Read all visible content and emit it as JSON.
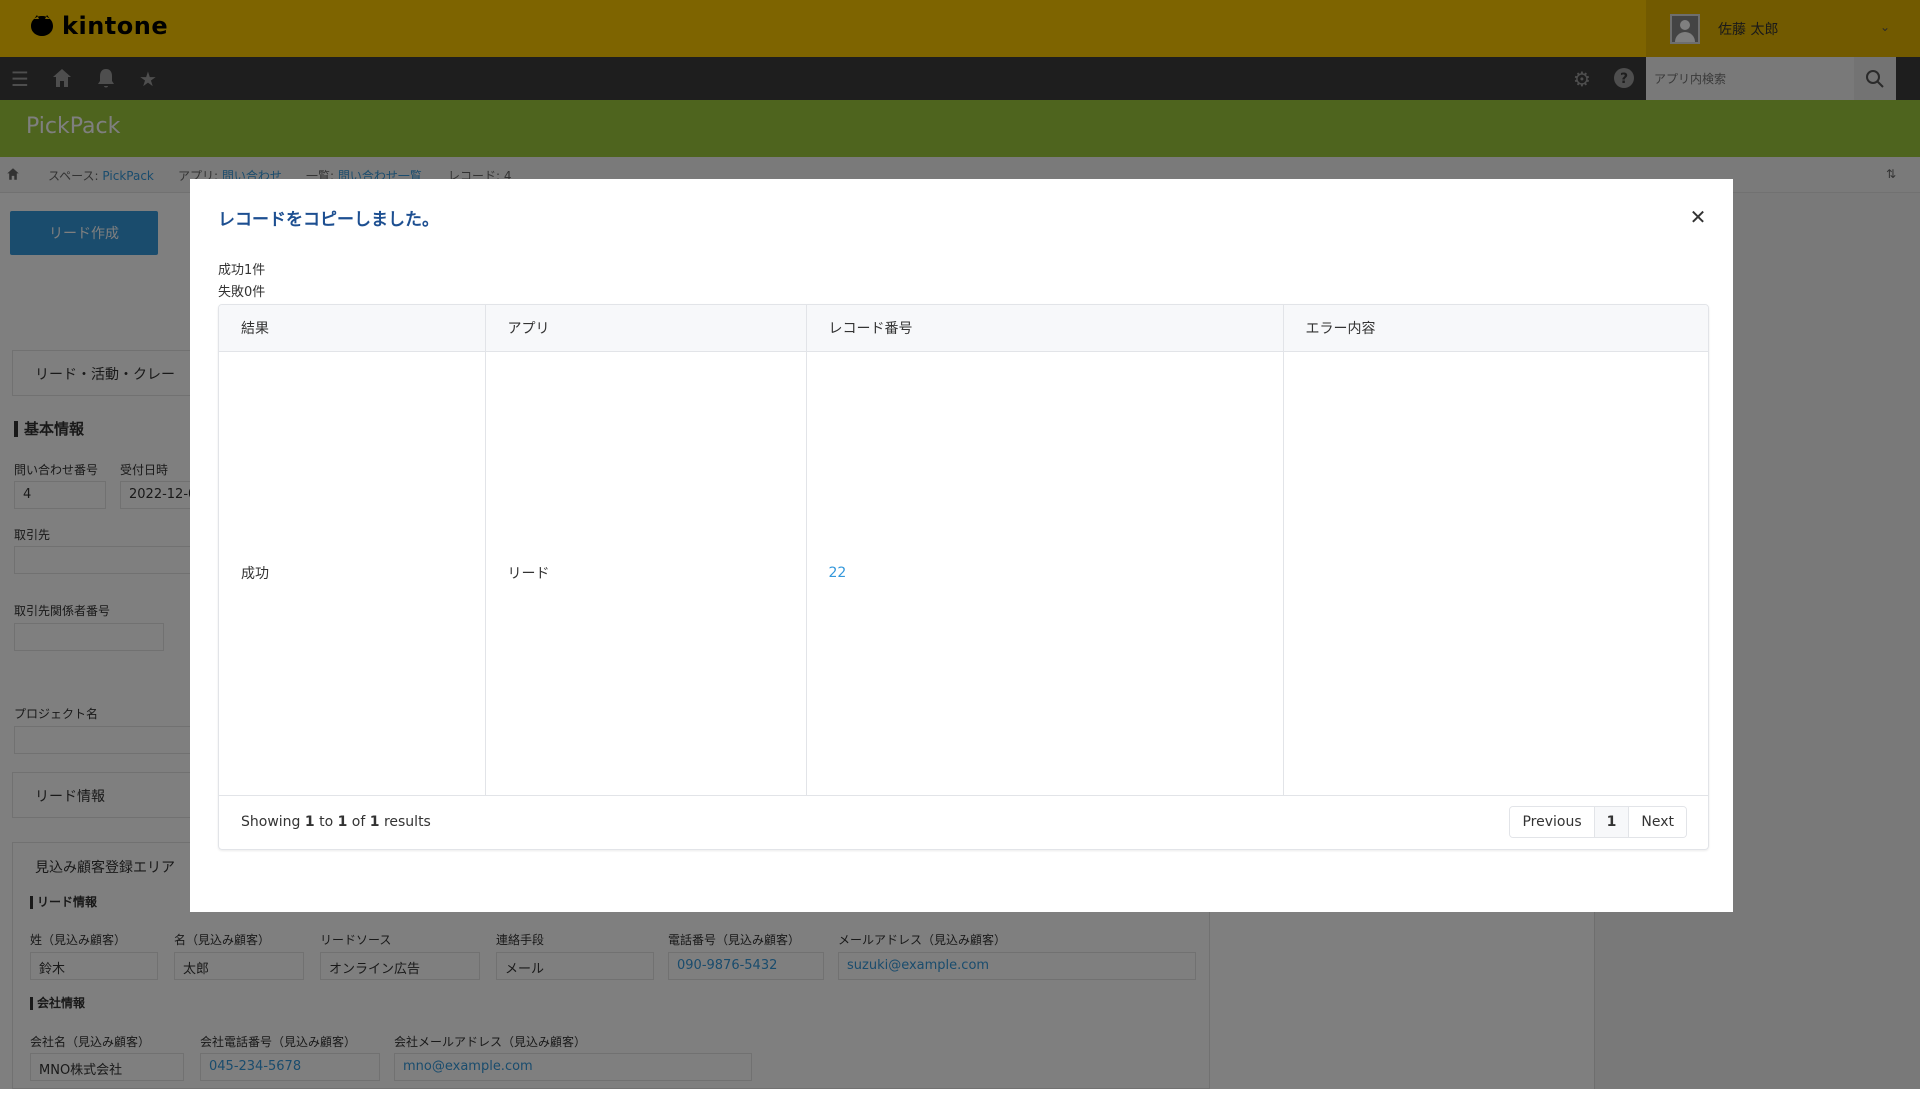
{
  "app": {
    "logo_text": "kintone",
    "user_name": "佐藤 太郎",
    "search_placeholder": "アプリ内検索",
    "space_title": "PickPack"
  },
  "breadcrumb": {
    "space_prefix": "スペース: ",
    "space_link": "PickPack",
    "app_prefix": "アプリ: ",
    "app_link": "問い合わせ",
    "list_prefix": "一覧: ",
    "list_link": "問い合わせ一覧",
    "record": "レコード: 4"
  },
  "background": {
    "lead_button": "リード作成",
    "group_activity": "リード・活動・クレー",
    "section_basic": "基本情報",
    "inquiry_no_label": "問い合わせ番号",
    "inquiry_no_value": "4",
    "received_label": "受付日時",
    "received_value": "2022-12-0",
    "customer_label": "取引先",
    "contact_no_label": "取引先関係者番号",
    "project_label": "プロジェクト名",
    "group_lead_info": "リード情報",
    "group_prospect": "見込み顧客登録エリア",
    "sub_lead_info": "リード情報",
    "last_name_label": "姓（見込み顧客）",
    "last_name_value": "鈴木",
    "first_name_label": "名（見込み顧客）",
    "first_name_value": "太郎",
    "lead_source_label": "リードソース",
    "lead_source_value": "オンライン広告",
    "contact_method_label": "連絡手段",
    "contact_method_value": "メール",
    "phone_label": "電話番号（見込み顧客）",
    "phone_value": "090-9876-5432",
    "email_label": "メールアドレス（見込み顧客）",
    "email_value": "suzuki@example.com",
    "sub_company_info": "会社情報",
    "company_name_label": "会社名（見込み顧客）",
    "company_name_value": "MNO株式会社",
    "company_phone_label": "会社電話番号（見込み顧客）",
    "company_phone_value": "045-234-5678",
    "company_email_label": "会社メールアドレス（見込み顧客）",
    "company_email_value": "mno@example.com"
  },
  "modal": {
    "title": "レコードをコピーしました。",
    "success_count": "成功1件",
    "failure_count": "失敗0件",
    "columns": [
      "結果",
      "アプリ",
      "レコード番号",
      "エラー内容"
    ],
    "rows": [
      {
        "result": "成功",
        "app": "リード",
        "record_no": "22",
        "error": ""
      }
    ],
    "footer": {
      "showing_prefix": "Showing ",
      "from": "1",
      "to_word": " to ",
      "to": "1",
      "of_word": " of ",
      "total": "1",
      "results_word": " results"
    },
    "pager": {
      "previous": "Previous",
      "page": "1",
      "next": "Next"
    }
  },
  "colors": {
    "header_yellow": "#fcc800",
    "nav_dark": "#3d3d3d",
    "space_green": "#9cc83c",
    "title_blue": "#1d4f91",
    "link_blue": "#3498db"
  }
}
